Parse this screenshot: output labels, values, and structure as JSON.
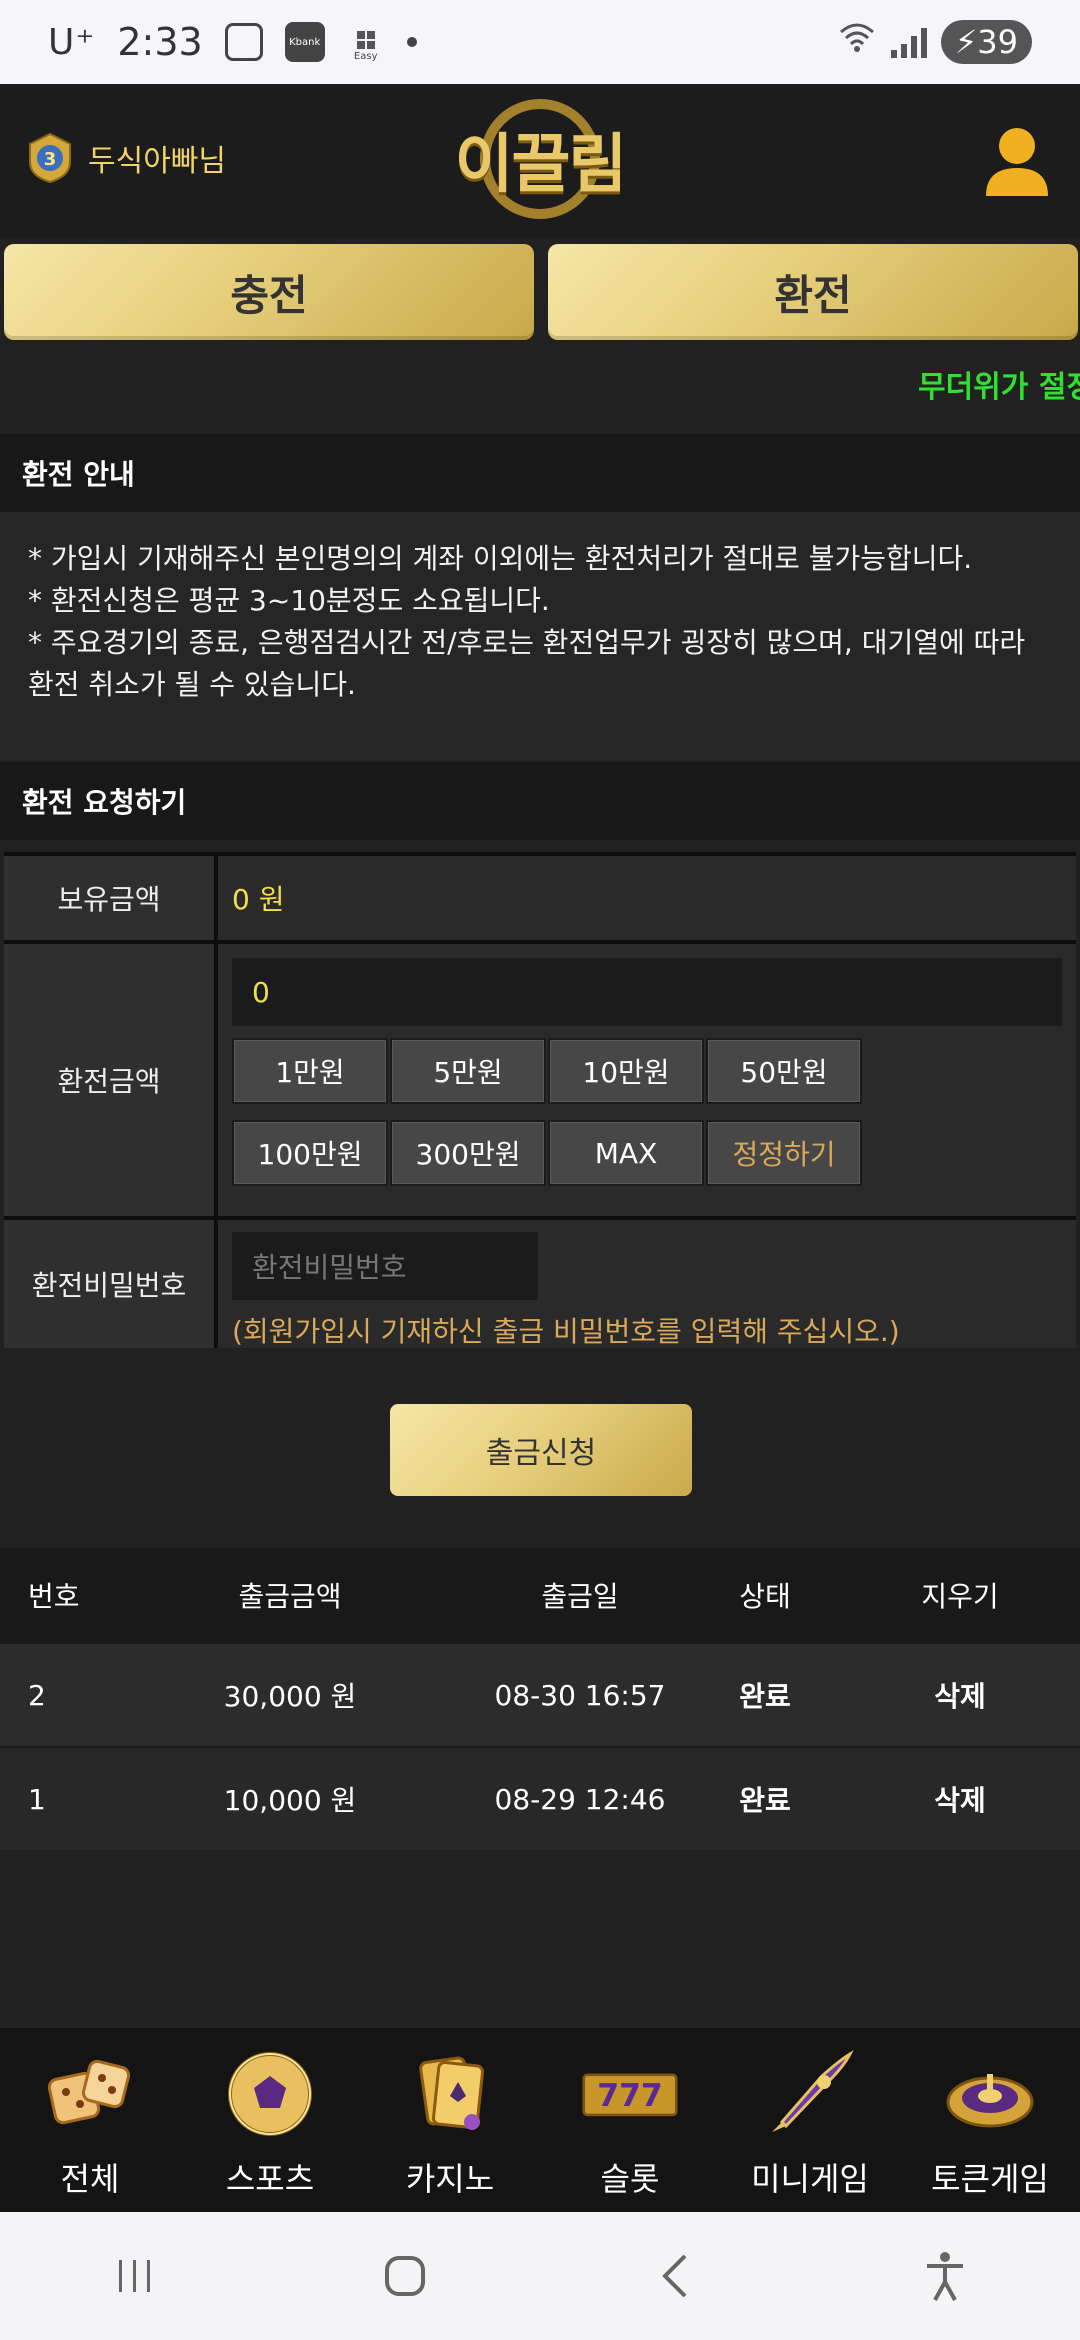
{
  "status_bar": {
    "carrier": "U⁺",
    "time": "2:33",
    "kbank": "Kbank",
    "easy": "Easy",
    "battery": "39"
  },
  "header": {
    "rank": "3",
    "user_name": "두식아빠님",
    "logo_text": "이끌림"
  },
  "top_buttons": {
    "deposit": "충전",
    "exchange": "환전"
  },
  "marquee_text": "무더위가 절정",
  "notice": {
    "title": "환전 안내",
    "lines": [
      "* 가입시 기재해주신 본인명의의 계좌 이외에는 환전처리가 절대로 불가능합니다.",
      "* 환전신청은 평균 3~10분정도 소요됩니다.",
      "* 주요경기의 종료, 은행점검시간 전/후로는 환전업무가 굉장히 많으며, 대기열에 따라",
      "환전 취소가 될 수 있습니다."
    ]
  },
  "request": {
    "title": "환전 요청하기",
    "balance_label": "보유금액",
    "balance_value": "0 원",
    "amount_label": "환전금액",
    "amount_value": "0",
    "chips": [
      "1만원",
      "5만원",
      "10만원",
      "50만원",
      "100만원",
      "300만원",
      "MAX",
      "정정하기"
    ],
    "password_label": "환전비밀번호",
    "password_placeholder": "환전비밀번호",
    "password_hint": "(회원가입시 기재하신 출금 비밀번호를 입력해 주십시오.)",
    "submit": "출금신청"
  },
  "history": {
    "headers": [
      "번호",
      "출금금액",
      "출금일",
      "상태",
      "지우기"
    ],
    "rows": [
      {
        "no": "2",
        "amount": "30,000 원",
        "date": "08-30 16:57",
        "status": "완료",
        "action": "삭제"
      },
      {
        "no": "1",
        "amount": "10,000 원",
        "date": "08-29 12:46",
        "status": "완료",
        "action": "삭제"
      }
    ]
  },
  "bottom_nav": [
    {
      "label": "전체",
      "icon": "dice-icon"
    },
    {
      "label": "스포츠",
      "icon": "soccer-ball-icon"
    },
    {
      "label": "카지노",
      "icon": "cards-icon"
    },
    {
      "label": "슬롯",
      "icon": "slot-777-icon"
    },
    {
      "label": "미니게임",
      "icon": "rocket-icon"
    },
    {
      "label": "토큰게임",
      "icon": "roulette-icon"
    }
  ],
  "colors": {
    "gold": "#e7d07e",
    "accent_yellow": "#f3de4a",
    "hint_orange": "#d9a85a",
    "marquee_green": "#30e030",
    "background": "#212121"
  }
}
